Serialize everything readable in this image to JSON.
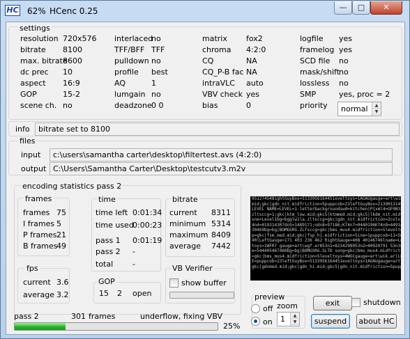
{
  "window": {
    "icon_text": "HC",
    "percent": "62%",
    "title": "HCenc 0.25",
    "minimize_glyph": "—",
    "maximize_glyph": "□",
    "close_glyph": "✕"
  },
  "settings": {
    "title": "settings",
    "rows": [
      [
        [
          "resolution",
          "720x576"
        ],
        [
          "interlaced",
          "no"
        ],
        [
          "matrix",
          "fox2"
        ],
        [
          "logfile",
          "yes"
        ]
      ],
      [
        [
          "bitrate",
          "8100"
        ],
        [
          "TFF/BFF",
          "TFF"
        ],
        [
          "chroma",
          "4:2:0"
        ],
        [
          "framelog",
          "yes"
        ]
      ],
      [
        [
          "max. bitrate",
          "8600"
        ],
        [
          "pulldown",
          "no"
        ],
        [
          "CQ",
          "NA"
        ],
        [
          "SCD file",
          "no"
        ]
      ],
      [
        [
          "dc prec",
          "10"
        ],
        [
          "profile",
          "best"
        ],
        [
          "CQ_P-B fac",
          "NA"
        ],
        [
          "mask/shift",
          "no"
        ]
      ],
      [
        [
          "aspect",
          "16:9"
        ],
        [
          "AQ",
          "1"
        ],
        [
          "intraVLC",
          "auto"
        ],
        [
          "lossless",
          "no"
        ]
      ],
      [
        [
          "GOP",
          "15-2"
        ],
        [
          "lumgain",
          "no"
        ],
        [
          "VBV check",
          "yes"
        ],
        [
          "SMP",
          "yes,  proc = 2"
        ]
      ],
      [
        [
          "scene ch.",
          "no"
        ],
        [
          "deadzone",
          "0  0"
        ],
        [
          "bias",
          "0"
        ],
        [
          "priority",
          ""
        ]
      ]
    ],
    "priority_value": "normal"
  },
  "info": {
    "label": "info",
    "text": "bitrate set to  8100"
  },
  "files": {
    "title": "files",
    "input_label": "input",
    "input_value": "c:\\users\\samantha carter\\desktop\\filtertest.avs   (4:2:0)",
    "output_label": "output",
    "output_value": "C:\\Users\\Samantha Carter\\Desktop\\testcutv3.m2v"
  },
  "stats": {
    "title": "encoding statistics pass 2",
    "frames": {
      "title": "frames",
      "rows": [
        [
          "frames",
          "75"
        ],
        [
          "I frames",
          "5"
        ],
        [
          "P frames",
          "21"
        ],
        [
          "B frames",
          "49"
        ]
      ]
    },
    "time": {
      "title": "time",
      "time_left_label": "time left",
      "time_left": "0:01:34",
      "time_used_label": "time used",
      "time_used": "0:00:23",
      "pass1_label": "pass 1",
      "pass1": "0:01:19",
      "pass2_label": "pass 2",
      "pass2": "-",
      "total_label": "total",
      "total": "-"
    },
    "bitrate": {
      "title": "bitrate",
      "rows": [
        [
          "current",
          "8311"
        ],
        [
          "minimum",
          "5314"
        ],
        [
          "maximum",
          "8409"
        ],
        [
          "average",
          "7442"
        ]
      ]
    },
    "fps": {
      "title": "fps",
      "current_label": "current",
      "current": "3.6",
      "average_label": "average",
      "average": "3.2"
    },
    "gop": {
      "title": "GOP",
      "v1": "15",
      "v2": "2",
      "v3": "open"
    },
    "vb_verifier": {
      "title": "VB Verifier",
      "show_buffer_label": "show buffer"
    }
  },
  "preview": {
    "title": "preview",
    "off_label": "off",
    "on_label": "on",
    "zoom_label": "zoom",
    "zoom_value": "1",
    "noise_lines": [
      "951274548ightGuyBox=5133956164451eveltoys=1AGAUgauge=art\\wik.ar|",
      "mid;gkc|gdn_nit.midfriction=5puppcob=23leftGuyBox=2139013145683|",
      "LEVEL NAME=LEVEL=1-letterbackgroundswd=kitchen|P{xml4=GF0N3345f",
      "zltsccg=1;gkc|ktm_low.mid;gkc5|ktmmed.mid;gkc5|lkdm_nit.midfri",
      "sne=Level1bg=bgglw1la.zltsccg=gkc|gdn_nit.midfriction=2color=1",
      "4n4=0193143R7dn5=1489171;ndn8=97186;K74n7=0440196K74n8=4491426",
      "30469bg=bg|BOMGSRG.ZLTsccg=gkc|bms_mus4.midfriction=5leveltoys",
      "p=gkc|fsm_med.mid;gkc|fsp_hi.midfriction=5ine=1puppcob=11=56ft",
      "40|LeftGauge=171 403 236 462 RightGauge=408 40146746lname=Level",
      "toys=1WFR7 gauge=art\\wgf.ar853n1=8234298053n2=40929791 53n3=1",
      "e=544405467460bg=bg|BOMGSRG.SLTD song=gkc|bms_mus4.midfriction",
      "=gkc|bms_mus4.midfriction=5leveltoys=4WGCgauge=art\\wik.ar|LEVEL",
      "E=puppcob=23leftGuyBox=5133956164451eveltoys=1AGAUgauge=art\\wi",
      "gkc|gdnmed.mid;gkc|gdn_hi.mid;gkc5|gdn_nit.midfriction=5puppcob"
    ]
  },
  "controls": {
    "exit": "exit",
    "shutdown": "shutdown",
    "suspend": "suspend",
    "about": "about  HC"
  },
  "status": {
    "pass": "pass 2",
    "frames_count": "301",
    "frames_label": "frames",
    "message": "underflow, fixing VBV",
    "percent": "25%",
    "progress_fraction": 0.25
  }
}
